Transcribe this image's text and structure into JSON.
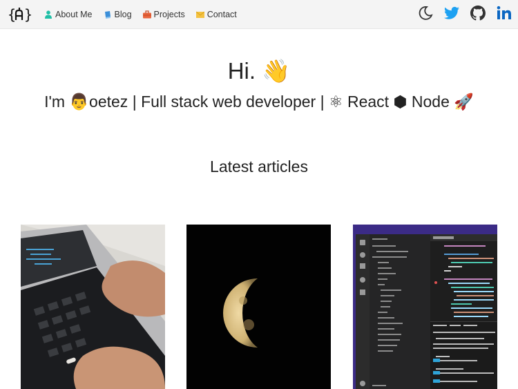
{
  "nav": {
    "logo_text": "{a}",
    "links": [
      {
        "label": "About Me",
        "icon": "user-icon",
        "color": "#1fbfa6"
      },
      {
        "label": "Blog",
        "icon": "book-icon",
        "color": "#3b8fd9"
      },
      {
        "label": "Projects",
        "icon": "briefcase-icon",
        "color": "#e8643c"
      },
      {
        "label": "Contact",
        "icon": "envelope-icon",
        "color": "#f4c242"
      }
    ],
    "right_icons": [
      "moon-icon",
      "twitter-icon",
      "github-icon",
      "linkedin-icon"
    ]
  },
  "hero": {
    "title": "Hi. 👋",
    "subtitle": "I'm 👨oetez | Full stack web developer | ⚛ React ⬢ Node 🚀"
  },
  "articles": {
    "heading": "Latest articles",
    "cards": [
      {
        "image": "laptop-typing-photo"
      },
      {
        "image": "moon-photo"
      },
      {
        "image": "vscode-editor-screenshot"
      }
    ]
  },
  "colors": {
    "navbar_bg": "#f4f4f4",
    "twitter": "#1da1f2",
    "linkedin": "#0a66c2",
    "vscode_purple": "#3b2b86"
  }
}
